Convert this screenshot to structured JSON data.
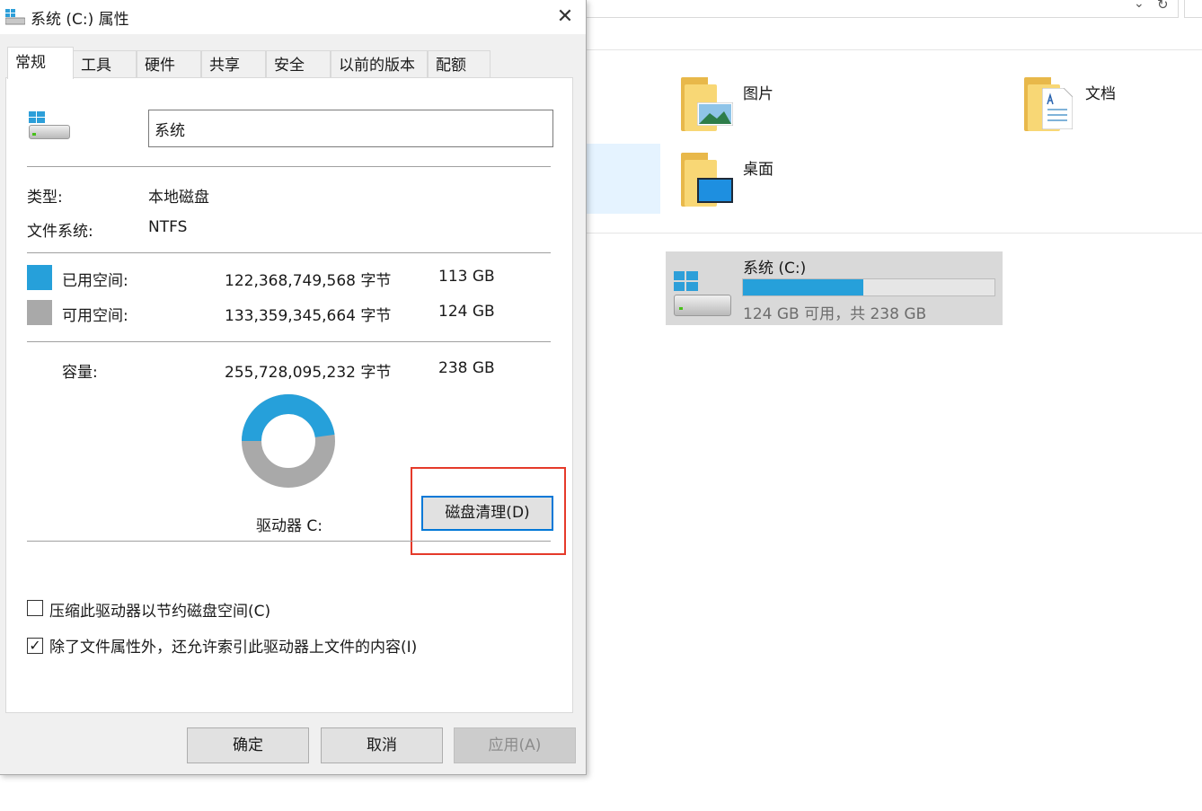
{
  "explorer": {
    "address_chevron": "⌄",
    "refresh_glyph": "↻",
    "folders": [
      {
        "label": "图片"
      },
      {
        "label": "文档"
      },
      {
        "label": "桌面"
      }
    ],
    "drive": {
      "name": "系统 (C:)",
      "used_fraction": 0.48,
      "info": "124 GB 可用，共 238 GB"
    }
  },
  "dialog": {
    "title": "系统 (C:) 属性",
    "close_glyph": "✕",
    "tabs": [
      "常规",
      "工具",
      "硬件",
      "共享",
      "安全",
      "以前的版本",
      "配额"
    ],
    "active_tab": "常规",
    "drive_name_value": "系统",
    "type_label": "类型:",
    "type_value": "本地磁盘",
    "fs_label": "文件系统:",
    "fs_value": "NTFS",
    "used": {
      "label": "已用空间:",
      "bytes": "122,368,749,568 字节",
      "size": "113 GB",
      "color": "#26a0da"
    },
    "free": {
      "label": "可用空间:",
      "bytes": "133,359,345,664 字节",
      "size": "124 GB",
      "color": "#a9a9a9"
    },
    "capacity": {
      "label": "容量:",
      "bytes": "255,728,095,232 字节",
      "size": "238 GB"
    },
    "used_fraction": 0.478,
    "drive_caption": "驱动器 C:",
    "cleanup_button": "磁盘清理(D)",
    "compress_checkbox": {
      "label": "压缩此驱动器以节约磁盘空间(C)",
      "checked": false
    },
    "index_checkbox": {
      "label": "除了文件属性外，还允许索引此驱动器上文件的内容(I)",
      "checked": true
    },
    "ok_button": "确定",
    "cancel_button": "取消",
    "apply_button": "应用(A)"
  },
  "colors": {
    "accent": "#26a0da",
    "highlight_frame": "#e53a2a"
  }
}
